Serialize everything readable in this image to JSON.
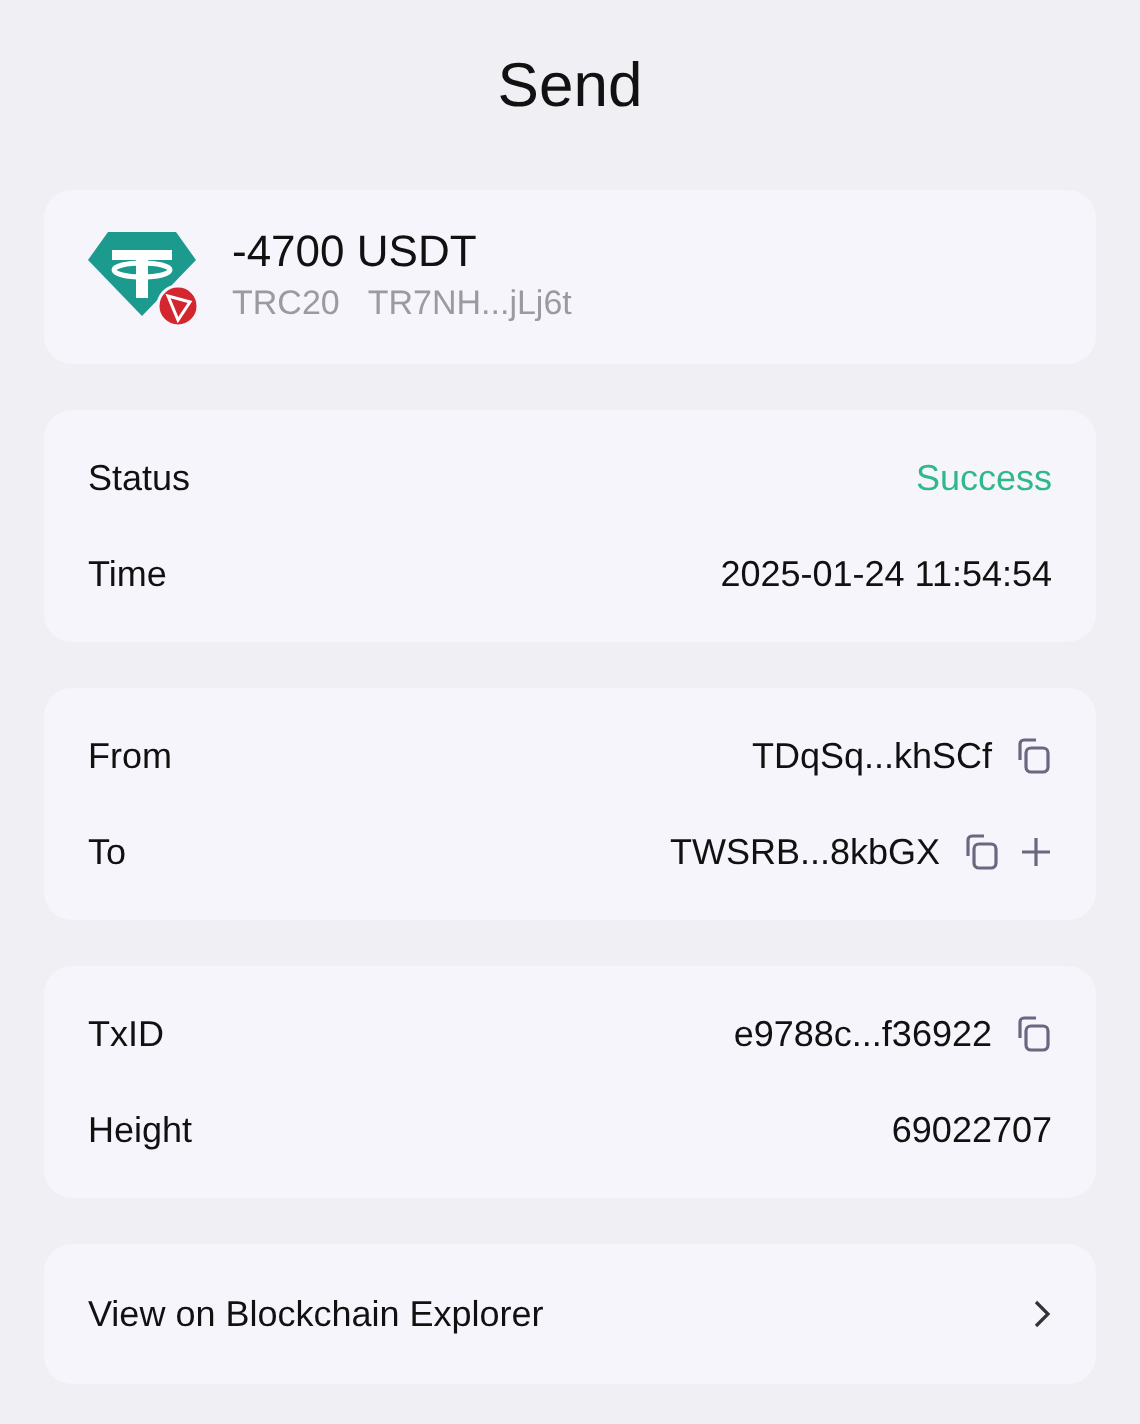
{
  "title": "Send",
  "asset": {
    "amount": "-4700 USDT",
    "network": "TRC20",
    "address": "TR7NH...jLj6t"
  },
  "sections": [
    {
      "rows": [
        {
          "label": "Status",
          "value": "Success",
          "success": true,
          "copyable": false,
          "addable": false
        },
        {
          "label": "Time",
          "value": "2025-01-24 11:54:54",
          "success": false,
          "copyable": false,
          "addable": false
        }
      ]
    },
    {
      "rows": [
        {
          "label": "From",
          "value": "TDqSq...khSCf",
          "success": false,
          "copyable": true,
          "addable": false
        },
        {
          "label": "To",
          "value": "TWSRB...8kbGX",
          "success": false,
          "copyable": true,
          "addable": true
        }
      ]
    },
    {
      "rows": [
        {
          "label": "TxID",
          "value": "e9788c...f36922",
          "success": false,
          "copyable": true,
          "addable": false
        },
        {
          "label": "Height",
          "value": "69022707",
          "success": false,
          "copyable": false,
          "addable": false
        }
      ]
    }
  ],
  "explorer_link": {
    "label": "View on Blockchain Explorer"
  }
}
